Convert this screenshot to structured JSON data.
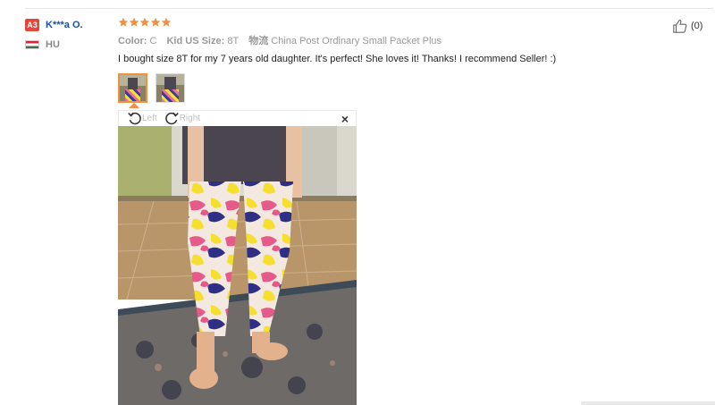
{
  "buyer": {
    "level": "A3",
    "name": "K***a O.",
    "country_code": "HU"
  },
  "feedback": {
    "rating": 5,
    "attributes": [
      {
        "key": "Color:",
        "value": "C"
      },
      {
        "key": "Kid US Size:",
        "value": "8T"
      },
      {
        "key": "物流",
        "value": "China Post Ordinary Small Packet Plus"
      }
    ],
    "comment": "I bought size 8T for my 7 years old daughter. It's perfect! She loves it! Thanks! I recommend Seller! :)"
  },
  "viewer": {
    "rotate_left_label": "Left",
    "rotate_right_label": "Right",
    "close_glyph": "×"
  },
  "helpful": {
    "count_text": "(0)"
  },
  "colors": {
    "stars": "#f19040",
    "buyer_name": "#1a4fa6",
    "level_badge": "#e5463a",
    "active_thumb_border": "#f19040"
  },
  "icons": [
    "star-icon",
    "rotate-left-icon",
    "rotate-right-icon",
    "close-icon",
    "thumbs-up-icon",
    "flag-hu-icon"
  ]
}
